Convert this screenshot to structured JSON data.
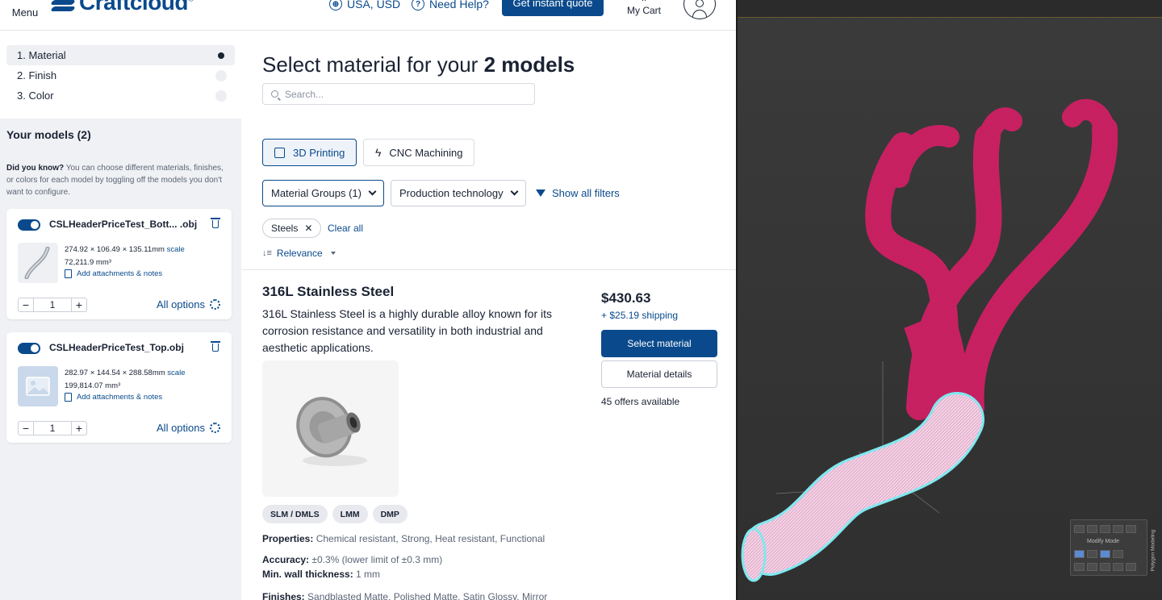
{
  "header": {
    "menu_label": "Menu",
    "brand": "Craftcloud",
    "brand_mark": "®",
    "locale": "USA, USD",
    "help": "Need Help?",
    "quote_button": "Get instant quote",
    "cart_label": "My Cart",
    "cart_dots": "⋅⋅"
  },
  "steps": [
    {
      "label": "1.  Material",
      "active": true
    },
    {
      "label": "2.  Finish",
      "active": false
    },
    {
      "label": "3.  Color",
      "active": false
    }
  ],
  "sidebar": {
    "models_title": "Your models (2)",
    "tip_bold": "Did you know?",
    "tip_text": " You can choose different materials, finishes, or colors for each model by toggling off the models you don't want to configure.",
    "models": [
      {
        "name": "CSLHeaderPriceTest_Bott... .obj",
        "dims": "274.92 × 106.49 × 135.11mm",
        "scale": "scale",
        "volume": "72,211.9 mm³",
        "attach": "Add attachments & notes",
        "qty": "1",
        "options": "All options"
      },
      {
        "name": "CSLHeaderPriceTest_Top.obj",
        "dims": "282.97 × 144.54 × 288.58mm",
        "scale": "scale",
        "volume": "199,814.07 mm³",
        "attach": "Add attachments & notes",
        "qty": "1",
        "options": "All options"
      }
    ],
    "minus": "−",
    "plus": "+"
  },
  "main": {
    "title_pre": "Select material for your ",
    "title_bold": "2 models",
    "search_placeholder": "Search...",
    "tech_3d": "3D Printing",
    "tech_cnc": "CNC Machining",
    "filter_groups": "Material Groups (1)",
    "filter_tech": "Production technology",
    "show_filters": "Show all filters",
    "chip": "Steels",
    "chip_x": "✕",
    "clear_all": "Clear all",
    "sort_icon": "↓≡",
    "sort": "Relevance"
  },
  "material": {
    "name": "316L Stainless Steel",
    "description": "316L Stainless Steel is a highly durable alloy known for its corrosion resistance and versatility in both industrial and aesthetic applications.",
    "tags": [
      "SLM / DMLS",
      "LMM",
      "DMP"
    ],
    "properties_label": "Properties:",
    "properties": " Chemical resistant, Strong, Heat resistant, Functional",
    "accuracy_label": "Accuracy:",
    "accuracy": " ±0.3% (lower limit of ±0.3 mm)",
    "wall_label": "Min. wall thickness:",
    "wall": " 1 mm",
    "finishes_label": "Finishes:",
    "finishes": " Sandblasted Matte, Polished Matte, Satin Glossy, Mirror",
    "price": "$430.63",
    "shipping": "+ $25.19 shipping",
    "select_button": "Select material",
    "details_button": "Material details",
    "offers": "45 offers available"
  },
  "viewport": {
    "modify_mode": "Modify Mode",
    "side_label": "Polygon Modeling",
    "colors": {
      "top_mesh": "#c41a5c",
      "selected_mesh": "#e8b7d3",
      "outline": "#7fe8f0",
      "background": "#333333"
    }
  }
}
